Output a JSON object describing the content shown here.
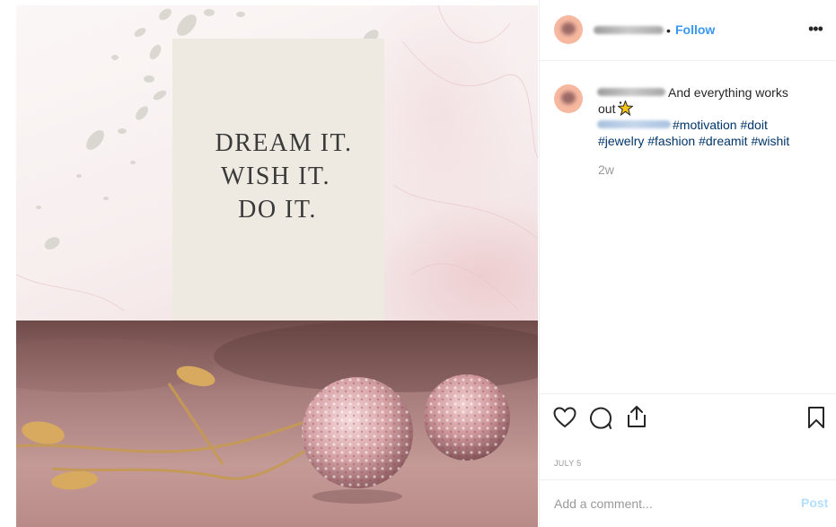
{
  "post": {
    "quote": {
      "line1": "DREAM IT.",
      "line2": "WISH IT.",
      "line3": "DO IT."
    }
  },
  "header": {
    "username_blurred": true,
    "separator": "•",
    "follow_label": "Follow",
    "more_label": "•••"
  },
  "caption": {
    "text_part1": "And everything works",
    "text_part2": "out",
    "star_icon": "sparkle-star-icon",
    "hashtags_line1": [
      "#motivation",
      "#doit"
    ],
    "hashtags_line2": [
      "#jewelry",
      "#fashion",
      "#dreamit",
      "#wishit"
    ],
    "time_ago": "2w"
  },
  "actions": {
    "icons": [
      "heart-icon",
      "comment-icon",
      "share-icon",
      "bookmark-icon"
    ],
    "date": "JULY 5"
  },
  "comment": {
    "placeholder": "Add a comment...",
    "post_label": "Post"
  },
  "colors": {
    "link_blue": "#3897f0",
    "hashtag_blue": "#003569",
    "post_disabled": "#b2dffc",
    "avatar": "#f7b8a0",
    "quote_card": "#eeeae1"
  }
}
